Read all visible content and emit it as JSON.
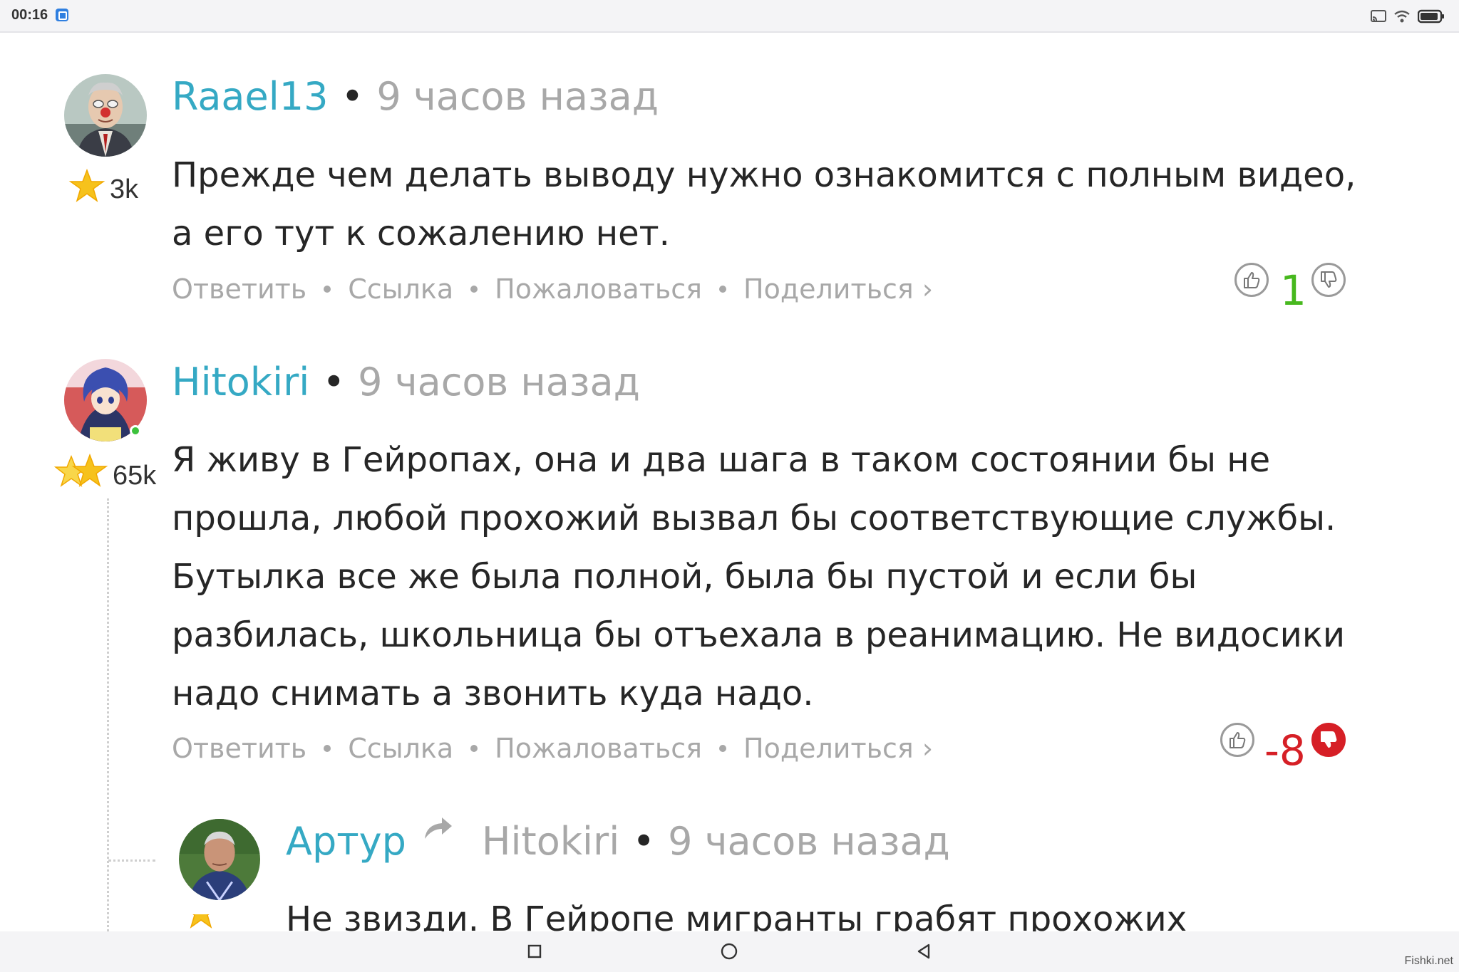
{
  "status_bar": {
    "time": "00:16",
    "icons": [
      "app-notification-icon",
      "cast-icon",
      "wifi-icon",
      "battery-icon"
    ]
  },
  "comments": [
    {
      "author": "Raael13",
      "time": "9 часов назад",
      "rating": "3k",
      "stars": 1,
      "online": false,
      "body_lines": [
        "Прежде чем делать выводу нужно ознакомится с полным видео,",
        "а его тут к сожалению нет."
      ],
      "score": "1",
      "vote_state": "none"
    },
    {
      "author": "Hitokiri",
      "time": "9 часов назад",
      "rating": "65k",
      "stars": 2,
      "online": true,
      "body_lines": [
        "Я живу в Гейропах, она и два шага в таком состоянии бы не",
        "прошла, любой прохожий вызвал бы соответствующие службы.",
        "Бутылка все же была полной, была бы пустой и если бы",
        "разбилась, школьница бы отъехала в реанимацию. Не видосики",
        "надо снимать а звонить куда надо."
      ],
      "score": "-8",
      "vote_state": "downvoted"
    },
    {
      "author": "Артур",
      "reply_to": "Hitokiri",
      "time": "9 часов назад",
      "stars": 1,
      "body_lines": [
        "Не звизди. В Гейропе мигранты грабят прохожих"
      ]
    }
  ],
  "actions": {
    "reply": "Ответить",
    "link": "Ссылка",
    "report": "Пожаловаться",
    "share": "Поделиться ›"
  },
  "nav_bar": {
    "buttons": [
      "recent-apps-button",
      "home-button",
      "back-button"
    ]
  },
  "watermark": "Fishki.net",
  "colors": {
    "author": "#35a9c4",
    "muted": "#a8a8a8",
    "positive": "#47b81e",
    "negative": "#d61f26",
    "text": "#262626"
  }
}
